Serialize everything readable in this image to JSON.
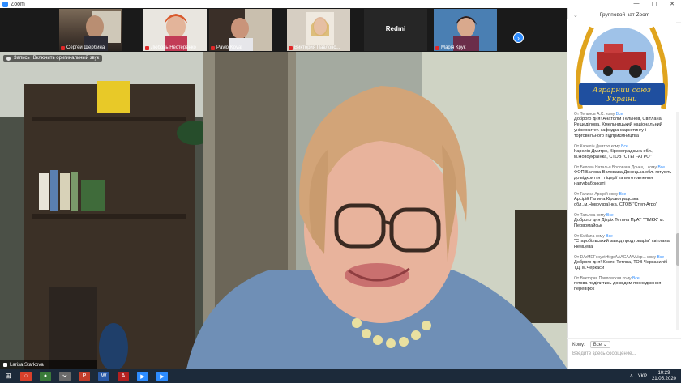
{
  "window": {
    "title": "Zoom",
    "controls": [
      "—",
      "▢",
      "✕"
    ]
  },
  "gallery": {
    "tiles": [
      {
        "name": "Сергей Щербина",
        "muted": true
      },
      {
        "name": "Любовь Нестеренко",
        "muted": true
      },
      {
        "name": "Pavlo Koval",
        "muted": true
      },
      {
        "name": "Виктория Павловс...",
        "muted": true
      },
      {
        "name": "Redmi",
        "muted": false
      },
      {
        "name": "Марія Крук",
        "muted": true
      }
    ],
    "next_label": "›"
  },
  "main": {
    "speaker_tag": "Включить оригинальный звук",
    "speaker_prefix": "Запись",
    "speaker_name": "Larisa Starkova"
  },
  "chat": {
    "header": "Групповой чат Zoom",
    "logo_text_1": "Аграрний союз",
    "logo_text_2": "України",
    "messages": [
      {
        "from": "Тельнов А.С.",
        "to": "Все",
        "body": "Доброго дня! Анатолій Тельнов, Світлана Рещедiлова. Хмельницький національний університет. кафедра маркетингу і торговельного підприємництва"
      },
      {
        "from": "Карелін Дмитро",
        "to": "Все",
        "body": "Карелін Дмитро, Кіровоградська обл., м.Новоукраїнка, СТОВ \"СТЕП-АГРО\""
      },
      {
        "from": "Белова Наталья Воловава Донец...",
        "to": "Все",
        "body": "ФОП Бєлова Воловава Донецька обл. готують до відкриття : піцерії та виготовлення напуфабрикатi"
      },
      {
        "from": "Галина Арсірій",
        "to": "Все",
        "body": "Арсірій Галина,Кіровоградська обл.,м.Новоукраїнка. СТОВ \"Степ-Агро\""
      },
      {
        "from": "Татьяна",
        "to": "Все",
        "body": "Доброго дня Дітріх Тетяна ПрАТ \"ПМКК\" м. Первомайськ"
      },
      {
        "from": "Svitlana",
        "to": "Все",
        "body": "\"Старобільський завод продтоварів\" світлана Немцева"
      },
      {
        "from": "DArMEFoxyetHtrgsAAAGAAAA/sp...",
        "to": "Все",
        "body": "Доброго дня! Косян Тетяна, ТОВ Черкасиліб ТД, м.Черкаси"
      },
      {
        "from": "Виктория Павловская",
        "to": "Все",
        "body": "готова поділитись досвідом проходження перевірок"
      }
    ],
    "from_prefix": "От",
    "to_prefix": "кому",
    "to_label": "Кому:",
    "to_value": "Все",
    "input_placeholder": "Введите здесь сообщение..."
  },
  "taskbar": {
    "lang": "УКР",
    "time": "10:29",
    "date": "21.05.2020"
  }
}
